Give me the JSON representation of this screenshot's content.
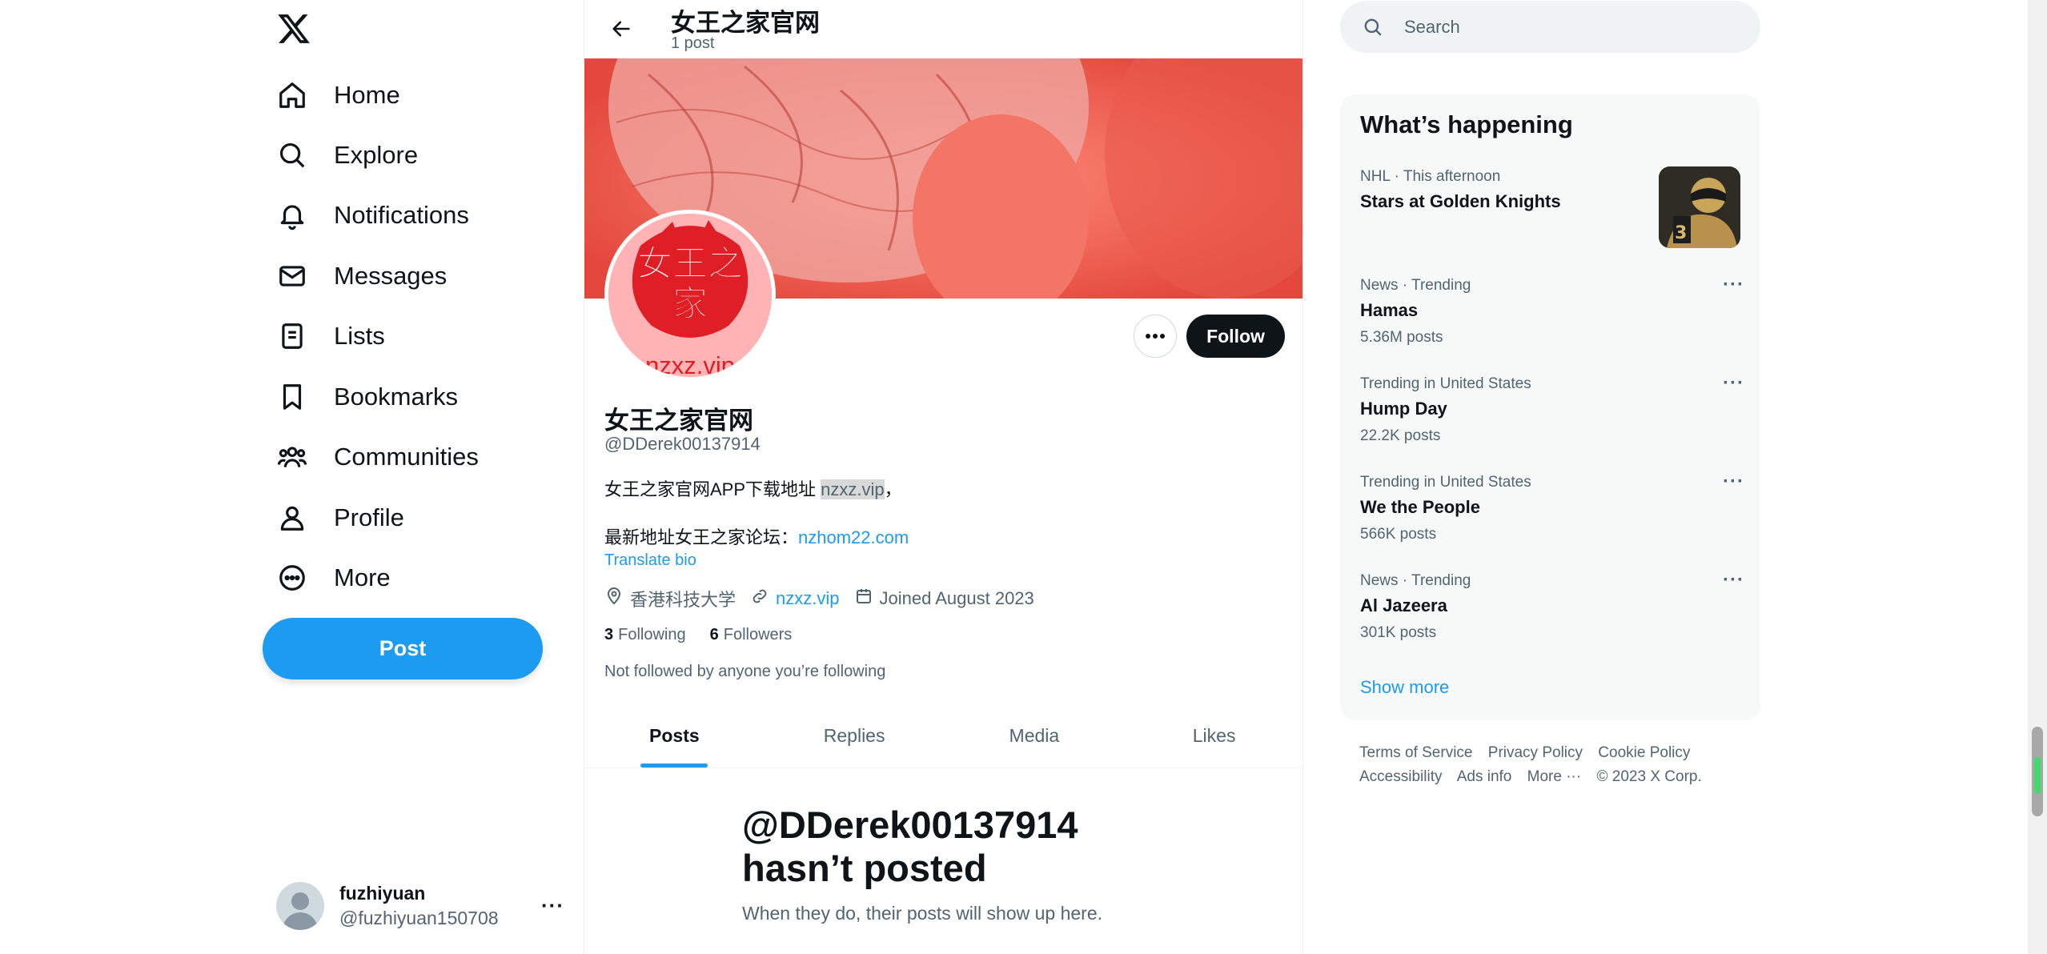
{
  "brand": {
    "logo_icon": "x-logo-icon"
  },
  "nav": {
    "items": [
      {
        "label": "Home",
        "icon": "home-icon"
      },
      {
        "label": "Explore",
        "icon": "search-icon"
      },
      {
        "label": "Notifications",
        "icon": "bell-icon"
      },
      {
        "label": "Messages",
        "icon": "envelope-icon"
      },
      {
        "label": "Lists",
        "icon": "list-icon"
      },
      {
        "label": "Bookmarks",
        "icon": "bookmark-icon"
      },
      {
        "label": "Communities",
        "icon": "people-icon"
      },
      {
        "label": "Profile",
        "icon": "person-icon"
      },
      {
        "label": "More",
        "icon": "more-circle-icon"
      }
    ],
    "post_label": "Post"
  },
  "account": {
    "name": "fuzhiyuan",
    "handle": "@fuzhiyuan150708"
  },
  "header": {
    "title": "女王之家官网",
    "subtitle": "1 post"
  },
  "profile": {
    "avatar_text_line1": "女王之",
    "avatar_text_line2": "家",
    "avatar_text_line3": "nzxz.vip",
    "follow_label": "Follow",
    "name": "女王之家官网",
    "handle": "@DDerek00137914",
    "bio_line1_prefix": "女王之家官网APP下载地址 ",
    "bio_line1_highlight": "nzxz.vip",
    "bio_line1_suffix": "，",
    "bio_line2_prefix": "最新地址女王之家论坛：",
    "bio_line2_link": "nzhom22.com",
    "translate_label": "Translate bio",
    "location": "香港科技大学",
    "website": "nzxz.vip",
    "joined": "Joined August 2023",
    "following_count": "3",
    "following_label": "Following",
    "followers_count": "6",
    "followers_label": "Followers",
    "not_followed": "Not followed by anyone you’re following"
  },
  "tabs": [
    "Posts",
    "Replies",
    "Media",
    "Likes"
  ],
  "active_tab": "Posts",
  "empty_state": {
    "title": "@DDerek00137914 hasn’t posted",
    "subtitle": "When they do, their posts will show up here."
  },
  "search": {
    "placeholder": "Search"
  },
  "whats_happening": {
    "title": "What’s happening",
    "trends": [
      {
        "context": "NHL · This afternoon",
        "title": "Stars at Golden Knights",
        "count": ""
      },
      {
        "context": "News · Trending",
        "title": "Hamas",
        "count": "5.36M posts"
      },
      {
        "context": "Trending in United States",
        "title": "Hump Day",
        "count": "22.2K posts"
      },
      {
        "context": "Trending in United States",
        "title": "We the People",
        "count": "566K posts"
      },
      {
        "context": "News · Trending",
        "title": "Al Jazeera",
        "count": "301K posts"
      }
    ],
    "show_more": "Show more"
  },
  "footer": {
    "links": [
      "Terms of Service",
      "Privacy Policy",
      "Cookie Policy",
      "Accessibility",
      "Ads info",
      "More ···"
    ],
    "copyright": "© 2023 X Corp."
  },
  "colors": {
    "accent": "#1d9bf0",
    "text": "#0f1419",
    "muted": "#536471"
  }
}
